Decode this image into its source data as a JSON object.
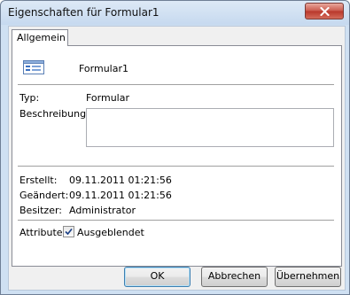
{
  "window": {
    "title": "Eigenschaften für Formular1"
  },
  "tabs": [
    {
      "label": "Allgemein"
    }
  ],
  "object": {
    "name": "Formular1",
    "icon": "form-icon"
  },
  "fields": {
    "typ_label": "Typ:",
    "typ_value": "Formular",
    "description_label": "Beschreibung:",
    "description_value": "",
    "created_label": "Erstellt:",
    "created_value": "09.11.2011 01:21:56",
    "modified_label": "Geändert:",
    "modified_value": "09.11.2011 01:21:56",
    "owner_label": "Besitzer:",
    "owner_value": "Administrator"
  },
  "attributes": {
    "label": "Attribute:",
    "hidden_label": "Ausgeblendet",
    "hidden_checked": true
  },
  "buttons": {
    "ok": "OK",
    "cancel": "Abbrechen",
    "apply": "Übernehmen"
  },
  "colors": {
    "close_button": "#c9574a",
    "titlebar": "#c6d9ef",
    "focus_border": "#3c7fb1"
  }
}
